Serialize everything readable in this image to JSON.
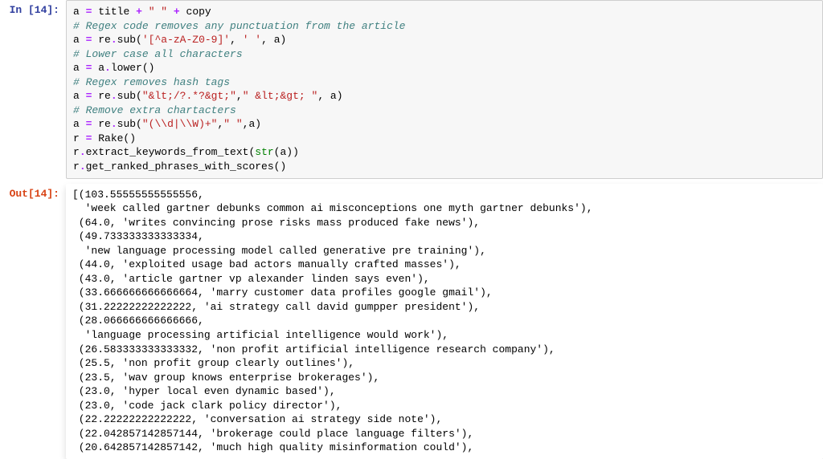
{
  "cell_in": {
    "prompt": "In [14]:",
    "lines": {
      "l1": {
        "tokens": [
          "a",
          " ",
          "=",
          " ",
          "title ",
          "+",
          " ",
          "\" \"",
          " ",
          "+",
          " ",
          "copy"
        ]
      },
      "l2": "# Regex code removes any punctuation from the article",
      "l3": {
        "pre": "a ",
        "op": "=",
        "mid": " re",
        "dot": ".",
        "fn": "sub(",
        "str": "'[^a-zA-Z0-9]'",
        "c1": ", ",
        "str2": "' '",
        "c2": ", a)"
      },
      "l4": "# Lower case all characters",
      "l5": {
        "pre": "a ",
        "op": "=",
        "post": " a",
        "dot": ".",
        "call": "lower()"
      },
      "l6": "# Regex removes hash tags",
      "l7": {
        "pre": "a ",
        "op": "=",
        "mid": " re",
        "dot": ".",
        "fn": "sub(",
        "str": "\"&lt;/?.*?&gt;\"",
        "c1": ",",
        "str2": "\" &lt;&gt; \"",
        "c2": ", a)"
      },
      "l8": "# Remove extra chartacters",
      "l9": {
        "pre": "a ",
        "op": "=",
        "mid": " re",
        "dot": ".",
        "fn": "sub(",
        "str": "\"(\\\\d|\\\\W)+\"",
        "c1": ",",
        "str2": "\" \"",
        "c2": ",a)"
      },
      "l10": {
        "pre": "r ",
        "op": "=",
        "post": " Rake()"
      },
      "l11": {
        "pre": "r",
        "dot": ".",
        "fn": "extract_keywords_from_text(",
        "builtin": "str",
        "rest": "(a))"
      },
      "l12": {
        "pre": "r",
        "dot": ".",
        "fn": "get_ranked_phrases_with_scores()"
      }
    }
  },
  "cell_out": {
    "prompt": "Out[14]:",
    "text": "[(103.55555555555556,\n  'week called gartner debunks common ai misconceptions one myth gartner debunks'),\n (64.0, 'writes convincing prose risks mass produced fake news'),\n (49.733333333333334,\n  'new language processing model called generative pre training'),\n (44.0, 'exploited usage bad actors manually crafted masses'),\n (43.0, 'article gartner vp alexander linden says even'),\n (33.666666666666664, 'marry customer data profiles google gmail'),\n (31.22222222222222, 'ai strategy call david gumpper president'),\n (28.066666666666666,\n  'language processing artificial intelligence would work'),\n (26.583333333333332, 'non profit artificial intelligence research company'),\n (25.5, 'non profit group clearly outlines'),\n (23.5, 'wav group knows enterprise brokerages'),\n (23.0, 'hyper local even dynamic based'),\n (23.0, 'code jack clark policy director'),\n (22.22222222222222, 'conversation ai strategy side note'),\n (22.042857142857144, 'brokerage could place language filters'),\n (20.642857142857142, 'much high quality misinformation could'),"
  }
}
